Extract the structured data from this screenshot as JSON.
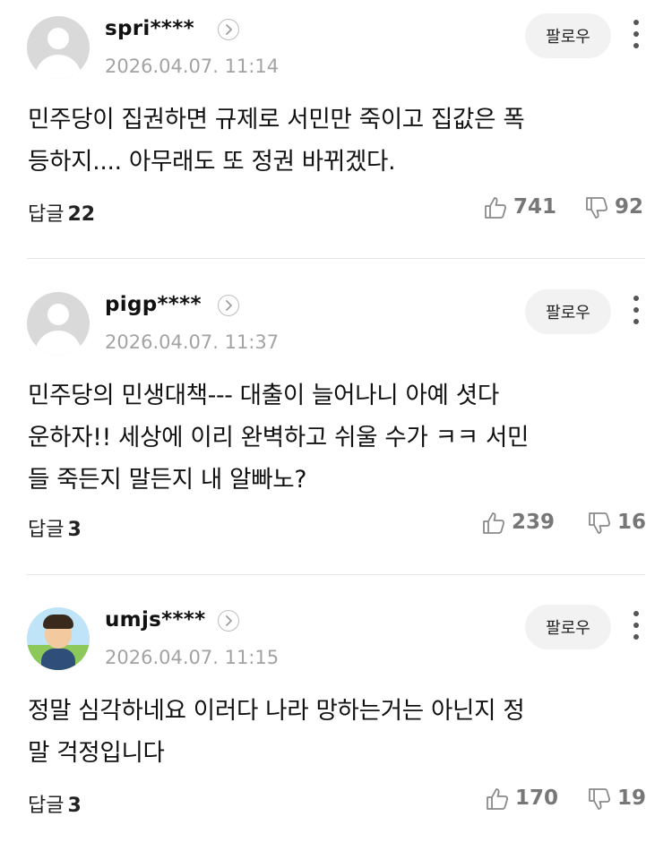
{
  "comments": [
    {
      "username": "spri****",
      "timestamp": "2026.04.07. 11:14",
      "follow_label": "팔로우",
      "avatar": "default-profile-icon",
      "text": "민주당이 집권하면 규제로 서민만 죽이고 집값은 폭\n등하지.... 아무래도 또 정권 바뀌겠다.",
      "replies_label": "답글",
      "replies_count": "22",
      "likes": "741",
      "dislikes": "92"
    },
    {
      "username": "pigp****",
      "timestamp": "2026.04.07. 11:37",
      "follow_label": "팔로우",
      "avatar": "default-profile-icon",
      "text": "민주당의 민생대책--- 대출이 늘어나니 아예 셧다\n운하자!! 세상에 이리 완벽하고 쉬울 수가 ㅋㅋ 서민\n들 죽든지 말든지 내 알빠노?",
      "replies_label": "답글",
      "replies_count": "3",
      "likes": "239",
      "dislikes": "16"
    },
    {
      "username": "umjs****",
      "timestamp": "2026.04.07. 11:15",
      "follow_label": "팔로우",
      "avatar": "user-photo-avatar",
      "text": "정말 심각하네요 이러다 나라 망하는거는 아닌지 정\n말 걱정입니다",
      "replies_label": "답글",
      "replies_count": "3",
      "likes": "170",
      "dislikes": "19"
    }
  ],
  "colors": {
    "text": "#111111",
    "timestamp": "#a3a3a3",
    "counts": "#777777",
    "follow_bg": "#f2f2f2",
    "divider": "#e5e5e5"
  }
}
